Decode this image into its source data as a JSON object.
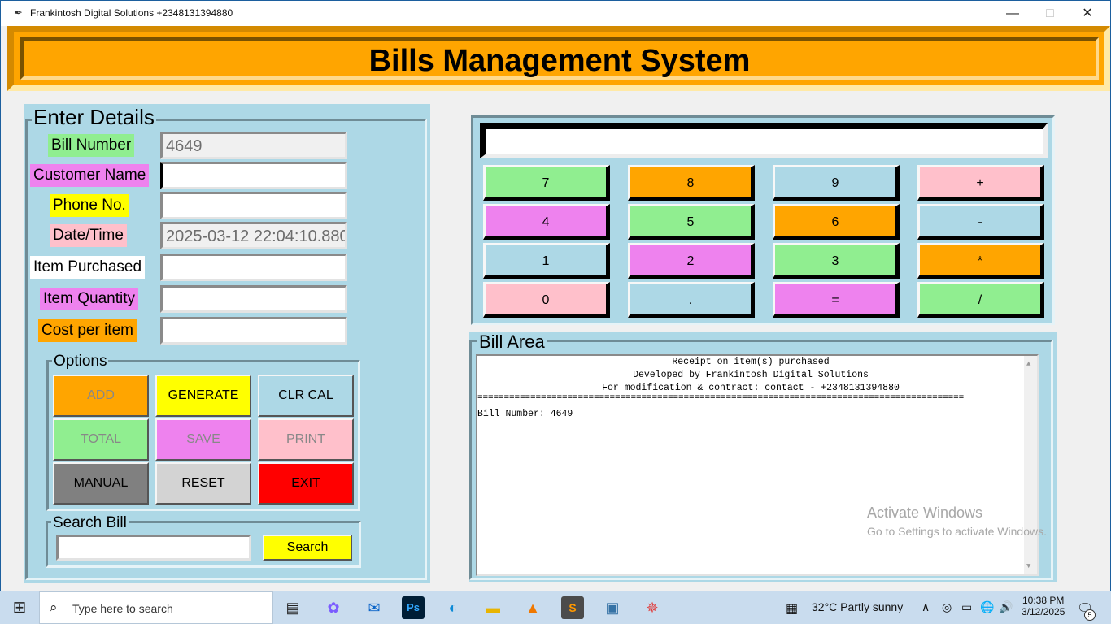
{
  "window": {
    "title": "Frankintosh Digital Solutions +2348131394880",
    "minimize": "—",
    "maximize": "□",
    "close": "✕"
  },
  "banner": {
    "title": "Bills Management System"
  },
  "details": {
    "group_title": "Enter Details",
    "fields": [
      {
        "label": "Bill Number",
        "value": "4649",
        "label_color": "#90ee90"
      },
      {
        "label": "Customer Name",
        "value": "",
        "label_color": "#ee82ee"
      },
      {
        "label": "Phone No.",
        "value": "",
        "label_color": "#ffff00"
      },
      {
        "label": "Date/Time",
        "value": "2025-03-12 22:04:10.880",
        "label_color": "#ffc0cb"
      },
      {
        "label": "Item Purchased",
        "value": "",
        "label_color": "#ffffff"
      },
      {
        "label": "Item Quantity",
        "value": "",
        "label_color": "#ee82ee"
      },
      {
        "label": "Cost per item",
        "value": "",
        "label_color": "#ffa500"
      }
    ]
  },
  "options": {
    "group_title": "Options",
    "buttons": [
      {
        "label": "ADD",
        "color": "#ffa500",
        "enabled": false
      },
      {
        "label": "GENERATE",
        "color": "#ffff00",
        "enabled": true
      },
      {
        "label": "CLR CAL",
        "color": "#add8e6",
        "enabled": true
      },
      {
        "label": "TOTAL",
        "color": "#90ee90",
        "enabled": false
      },
      {
        "label": "SAVE",
        "color": "#ee82ee",
        "enabled": false
      },
      {
        "label": "PRINT",
        "color": "#ffc0cb",
        "enabled": false
      },
      {
        "label": "MANUAL",
        "color": "#808080",
        "enabled": true
      },
      {
        "label": "RESET",
        "color": "#d3d3d3",
        "enabled": true
      },
      {
        "label": "EXIT",
        "color": "#ff0000",
        "enabled": true
      }
    ]
  },
  "search": {
    "group_title": "Search Bill",
    "value": "",
    "button": "Search"
  },
  "calculator": {
    "display": "",
    "keys": [
      {
        "label": "7",
        "color": "#90ee90"
      },
      {
        "label": "8",
        "color": "#ffa500"
      },
      {
        "label": "9",
        "color": "#add8e6"
      },
      {
        "label": "+",
        "color": "#ffc0cb"
      },
      {
        "label": "4",
        "color": "#ee82ee"
      },
      {
        "label": "5",
        "color": "#90ee90"
      },
      {
        "label": "6",
        "color": "#ffa500"
      },
      {
        "label": "-",
        "color": "#add8e6"
      },
      {
        "label": "1",
        "color": "#add8e6"
      },
      {
        "label": "2",
        "color": "#ee82ee"
      },
      {
        "label": "3",
        "color": "#90ee90"
      },
      {
        "label": "*",
        "color": "#ffa500"
      },
      {
        "label": "0",
        "color": "#ffc0cb"
      },
      {
        "label": ".",
        "color": "#add8e6"
      },
      {
        "label": "=",
        "color": "#ee82ee"
      },
      {
        "label": "/",
        "color": "#90ee90"
      }
    ]
  },
  "bill_area": {
    "group_title": "Bill Area",
    "lines": [
      "Receipt on item(s) purchased",
      "Developed by Frankintosh Digital Solutions",
      "For modification & contract: contact - +2348131394880",
      "============================================================================================",
      "Bill Number: 4649"
    ]
  },
  "watermark": {
    "line1": "Activate Windows",
    "line2": "Go to Settings to activate Windows."
  },
  "taskbar": {
    "search_placeholder": "Type here to search",
    "weather": "32°C  Partly sunny",
    "time": "10:38 PM",
    "date": "3/12/2025",
    "notifications": "5",
    "apps": [
      "task-view-icon",
      "copilot-icon",
      "mail-icon",
      "photoshop-icon",
      "edge-icon",
      "file-explorer-icon",
      "vlc-icon",
      "sublime-text-icon",
      "python-icon",
      "pinwheel-app-icon"
    ]
  }
}
